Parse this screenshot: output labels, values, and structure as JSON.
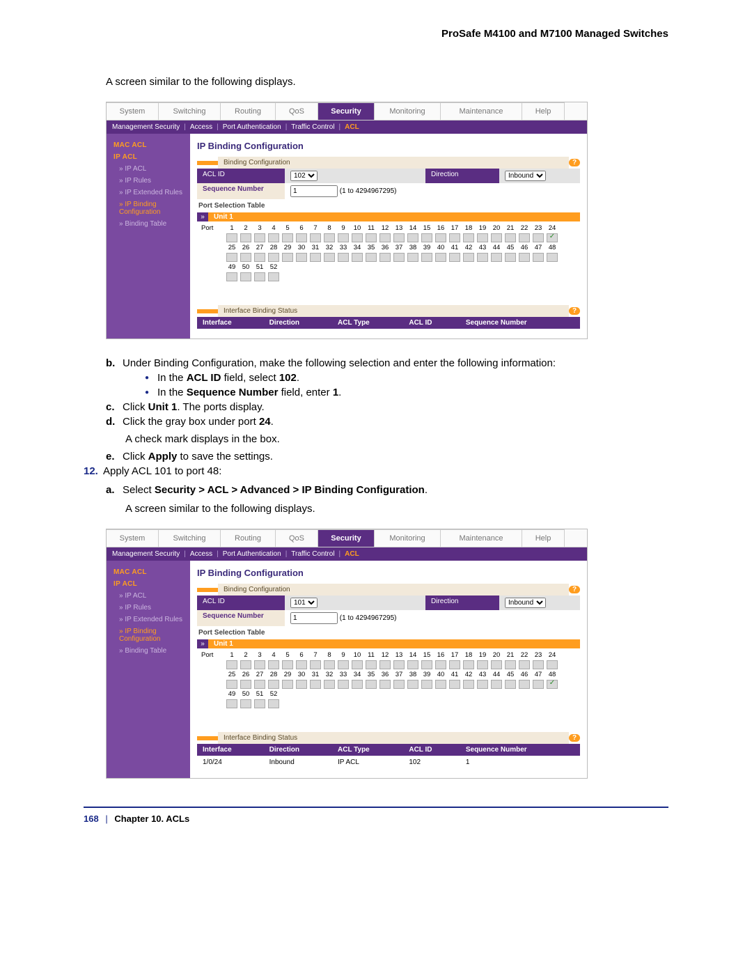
{
  "header": {
    "title": "ProSafe M4100 and M7100 Managed Switches"
  },
  "intro1": "A screen similar to the following displays.",
  "screenshot1": {
    "tabs": [
      "System",
      "Switching",
      "Routing",
      "QoS",
      "Security",
      "Monitoring",
      "Maintenance",
      "Help"
    ],
    "tab_widths": [
      74,
      88,
      78,
      60,
      80,
      94,
      116,
      60
    ],
    "active_tab": 4,
    "subnav": {
      "items": [
        "Management Security",
        "Access",
        "Port Authentication",
        "Traffic Control",
        "ACL"
      ],
      "active": 4
    },
    "sidebar": [
      {
        "label": "MAC ACL",
        "cls": "section"
      },
      {
        "label": "IP ACL",
        "cls": "section"
      },
      {
        "label": "IP ACL",
        "cls": "sub"
      },
      {
        "label": "IP Rules",
        "cls": "sub"
      },
      {
        "label": "IP Extended Rules",
        "cls": "sub"
      },
      {
        "label": "IP Binding Configuration",
        "cls": "sub sel"
      },
      {
        "label": "Binding Table",
        "cls": "sub"
      }
    ],
    "panel_title": "IP Binding Configuration",
    "binding_section": "Binding Configuration",
    "acl_id_label": "ACL ID",
    "acl_id_value": "102",
    "direction_label": "Direction",
    "direction_value": "Inbound",
    "seq_label": "Sequence Number",
    "seq_value": "1",
    "seq_hint": "(1 to 4294967295)",
    "port_sel_title": "Port Selection Table",
    "unit_label": "Unit 1",
    "checked_port": 24,
    "interface_section": "Interface Binding Status",
    "cols": [
      "Interface",
      "Direction",
      "ACL Type",
      "ACL ID",
      "Sequence Number"
    ],
    "rows": []
  },
  "instr": {
    "b_lead": "Under Binding Configuration, make the following selection and enter the following information:",
    "b1_pre": "In the ",
    "b1_bold": "ACL ID",
    "b1_post": " field, select ",
    "b1_val": "102",
    "b1_end": ".",
    "b2_pre": "In the ",
    "b2_bold": "Sequence Number",
    "b2_post": " field, enter ",
    "b2_val": "1",
    "b2_end": ".",
    "c_pre": "Click ",
    "c_bold": "Unit 1",
    "c_post": ". The ports display.",
    "d_pre": "Click the gray box under port ",
    "d_val": "24",
    "d_end": ".",
    "d_note": "A check mark displays in the box.",
    "e_pre": "Click ",
    "e_bold": "Apply",
    "e_post": " to save the settings.",
    "step12": "Apply ACL 101 to port 48:",
    "a_pre": "Select ",
    "a_bold": "Security > ACL > Advanced > IP Binding Configuration",
    "a_end": ".",
    "a_note": "A screen similar to the following displays."
  },
  "screenshot2": {
    "tabs": [
      "System",
      "Switching",
      "Routing",
      "QoS",
      "Security",
      "Monitoring",
      "Maintenance",
      "Help"
    ],
    "tab_widths": [
      74,
      88,
      78,
      60,
      80,
      94,
      116,
      60
    ],
    "active_tab": 4,
    "subnav": {
      "items": [
        "Management Security",
        "Access",
        "Port Authentication",
        "Traffic Control",
        "ACL"
      ],
      "active": 4
    },
    "sidebar": [
      {
        "label": "MAC ACL",
        "cls": "section"
      },
      {
        "label": "IP ACL",
        "cls": "section"
      },
      {
        "label": "IP ACL",
        "cls": "sub"
      },
      {
        "label": "IP Rules",
        "cls": "sub"
      },
      {
        "label": "IP Extended Rules",
        "cls": "sub"
      },
      {
        "label": "IP Binding Configuration",
        "cls": "sub sel"
      },
      {
        "label": "Binding Table",
        "cls": "sub"
      }
    ],
    "panel_title": "IP Binding Configuration",
    "binding_section": "Binding Configuration",
    "acl_id_label": "ACL ID",
    "acl_id_value": "101",
    "direction_label": "Direction",
    "direction_value": "Inbound",
    "seq_label": "Sequence Number",
    "seq_value": "1",
    "seq_hint": "(1 to 4294967295)",
    "port_sel_title": "Port Selection Table",
    "unit_label": "Unit 1",
    "checked_port": 48,
    "interface_section": "Interface Binding Status",
    "cols": [
      "Interface",
      "Direction",
      "ACL Type",
      "ACL ID",
      "Sequence Number"
    ],
    "rows": [
      [
        "1/0/24",
        "Inbound",
        "IP ACL",
        "102",
        "1"
      ]
    ]
  },
  "footer": {
    "page": "168",
    "sep": "|",
    "chapter": "Chapter 10.  ACLs"
  },
  "labels": {
    "b": "b.",
    "c": "c.",
    "d": "d.",
    "e": "e.",
    "a": "a.",
    "n12": "12.",
    "port_word": "Port"
  }
}
